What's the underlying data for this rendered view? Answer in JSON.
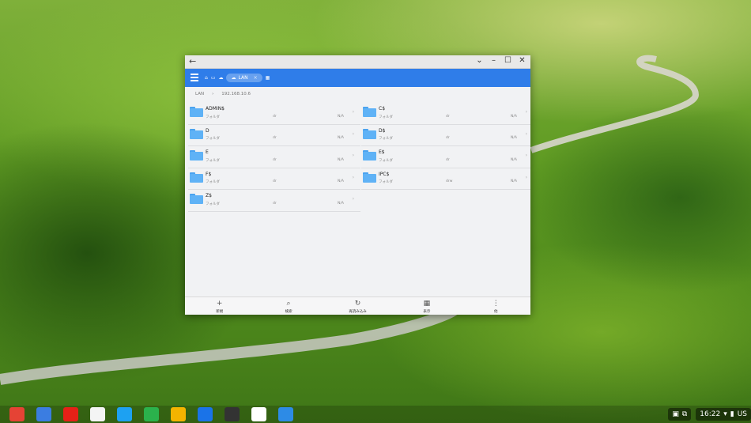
{
  "window": {
    "controls": [
      "minimize",
      "maximize",
      "close"
    ]
  },
  "toolbar": {
    "crumb_icons": [
      "home-icon",
      "device-icon",
      "cloud-icon"
    ],
    "active_crumb": "LAN",
    "close_glyph": "×",
    "trailing_icon": "grid-icon"
  },
  "path": {
    "root": "LAN",
    "host": "192.168.10.6"
  },
  "files": [
    {
      "name": "ADMIN$",
      "type": "フォルダ",
      "perm": "dr",
      "size": "N/A"
    },
    {
      "name": "C$",
      "type": "フォルダ",
      "perm": "dr",
      "size": "N/A"
    },
    {
      "name": "D",
      "type": "フォルダ",
      "perm": "dr",
      "size": "N/A"
    },
    {
      "name": "D$",
      "type": "フォルダ",
      "perm": "dr",
      "size": "N/A"
    },
    {
      "name": "E",
      "type": "フォルダ",
      "perm": "dr",
      "size": "N/A"
    },
    {
      "name": "E$",
      "type": "フォルダ",
      "perm": "dr",
      "size": "N/A"
    },
    {
      "name": "F$",
      "type": "フォルダ",
      "perm": "dr",
      "size": "N/A"
    },
    {
      "name": "IPC$",
      "type": "フォルダ",
      "perm": "drw",
      "size": "N/A"
    },
    {
      "name": "Z$",
      "type": "フォルダ",
      "perm": "dr",
      "size": "N/A"
    }
  ],
  "bottom_bar": [
    {
      "icon": "+",
      "label": "新規"
    },
    {
      "icon": "⌕",
      "label": "検索"
    },
    {
      "icon": "↻",
      "label": "再読み込み"
    },
    {
      "icon": "▦",
      "label": "表示"
    },
    {
      "icon": "⋮",
      "label": "他"
    }
  ],
  "shelf": {
    "apps": [
      "gmail-icon",
      "docs-icon",
      "youtube-icon",
      "chrome-icon",
      "twitter-icon",
      "feedly-icon",
      "drive-icon",
      "files-icon",
      "terminal-icon",
      "play-store-icon",
      "es-file-explorer-icon"
    ],
    "time": "16:22",
    "ime": "US"
  },
  "colors": {
    "accent": "#2f7de9",
    "folder": "#5fb2f6"
  }
}
